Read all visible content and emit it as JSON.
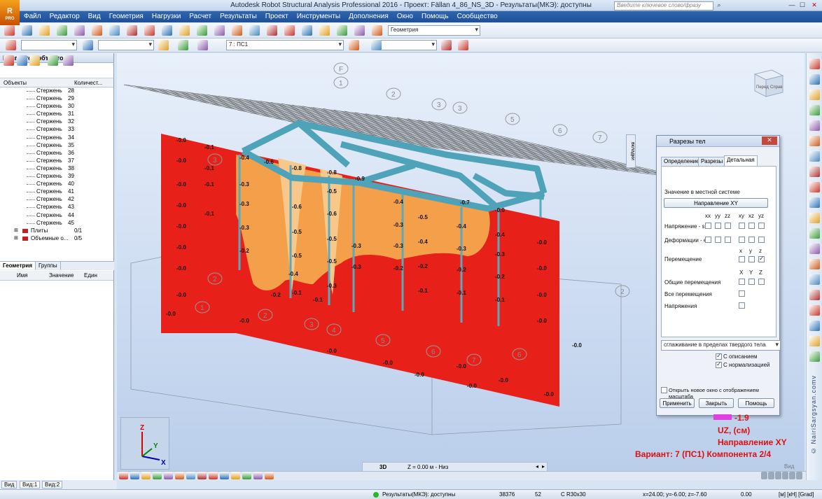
{
  "app": {
    "title": "Autodesk Robot Structural Analysis Professional 2016 - Проект: Fällan 4_86_NS_3D - Результаты(МКЭ): доступны",
    "logo_text": "R",
    "logo_sub": "PRO",
    "search_placeholder": "Введите ключевое слово/фразу"
  },
  "menu": [
    "Файл",
    "Редактор",
    "Вид",
    "Геометрия",
    "Нагрузки",
    "Расчет",
    "Результаты",
    "Проект",
    "Инструменты",
    "Дополнения",
    "Окно",
    "Помощь",
    "Сообщество"
  ],
  "toolbar": {
    "layout_combo": "Геометрия",
    "case_combo": "7 : ПС1"
  },
  "inspector": {
    "title": "Инспектор объектов",
    "col_objects": "Объекты",
    "col_count": "Количест...",
    "items": [
      {
        "name": "Стержень",
        "count": "28"
      },
      {
        "name": "Стержень",
        "count": "29"
      },
      {
        "name": "Стержень",
        "count": "30"
      },
      {
        "name": "Стержень",
        "count": "31"
      },
      {
        "name": "Стержень",
        "count": "32"
      },
      {
        "name": "Стержень",
        "count": "33"
      },
      {
        "name": "Стержень",
        "count": "34"
      },
      {
        "name": "Стержень",
        "count": "35"
      },
      {
        "name": "Стержень",
        "count": "36"
      },
      {
        "name": "Стержень",
        "count": "37"
      },
      {
        "name": "Стержень",
        "count": "38"
      },
      {
        "name": "Стержень",
        "count": "39"
      },
      {
        "name": "Стержень",
        "count": "40"
      },
      {
        "name": "Стержень",
        "count": "41"
      },
      {
        "name": "Стержень",
        "count": "42"
      },
      {
        "name": "Стержень",
        "count": "43"
      },
      {
        "name": "Стержень",
        "count": "44"
      },
      {
        "name": "Стержень",
        "count": "45"
      }
    ],
    "groups": [
      {
        "name": "Плиты",
        "count": "0/1"
      },
      {
        "name": "Объемные о...",
        "count": "0/5"
      }
    ],
    "tabs": [
      "Геометрия",
      "Группы"
    ],
    "prop_cols": [
      "Имя",
      "Значение",
      "Един"
    ]
  },
  "viewport": {
    "axis_labels": [
      "F",
      "1",
      "2",
      "3",
      "4",
      "5",
      "6",
      "7"
    ],
    "values": [
      "-0.0",
      "-0.1",
      "-0.2",
      "-0.3",
      "-0.4",
      "-0.5",
      "-0.6",
      "-0.7",
      "-0.8",
      "-0.9"
    ],
    "cube_front": "Перед",
    "cube_right": "Справ",
    "triad": {
      "z": "Z",
      "y": "Y",
      "x": "X"
    }
  },
  "dialog": {
    "title": "Разрезы тел",
    "tabs": [
      "Определение",
      "Разрезы",
      "Детальная"
    ],
    "side_tab": "вкладки",
    "section_label": "Значение в местной системе",
    "direction_button": "Направление XY",
    "components6": [
      "xx",
      "yy",
      "zz",
      "xy",
      "xz",
      "yz"
    ],
    "row_stress": "Напряжение - s",
    "row_strain": "Деформации - e",
    "components3": [
      "x",
      "y",
      "z"
    ],
    "row_disp": "Перемещение",
    "components3b": [
      "X",
      "Y",
      "Z"
    ],
    "row_gen_disp": "Общие перемещения",
    "row_all_disp": "Все перемещения",
    "row_stresses": "Напряжения",
    "smoothing": "сглаживание в пределах твердого тела",
    "opt_desc": "С описанием",
    "opt_norm": "С нормализацией",
    "open_new": "Открыть новое окно с отображением масштаба",
    "btn_apply": "Применить",
    "btn_close": "Закрыть",
    "btn_help": "Помощь"
  },
  "legend": {
    "min_value": "-1.9",
    "quantity": "UZ, (см)",
    "direction": "Направление XY",
    "variant": "Вариант: 7 (ПС1) Компонента 2/4"
  },
  "viewbar": {
    "mode": "3D",
    "z_level": "Z = 0.00 м - Низ",
    "view": "Вид"
  },
  "bottom_tabs": [
    "Вид",
    "Вид:1",
    "Вид:2"
  ],
  "status": {
    "results": "Результаты(МКЭ): доступны",
    "nodes": "38376",
    "bars": "52",
    "section": "С R30x30",
    "coords": "x=24.00; y=-6.00; z=-7.60",
    "value": "0.00",
    "units": "[м] [кН] [Grad]"
  },
  "watermark": "© NairiSargsyan.comv",
  "colors": {
    "plane": "#e8201a",
    "contour": "#f4a04a",
    "beam": "#4fa3b8",
    "title_bar": "#1f4f96"
  }
}
